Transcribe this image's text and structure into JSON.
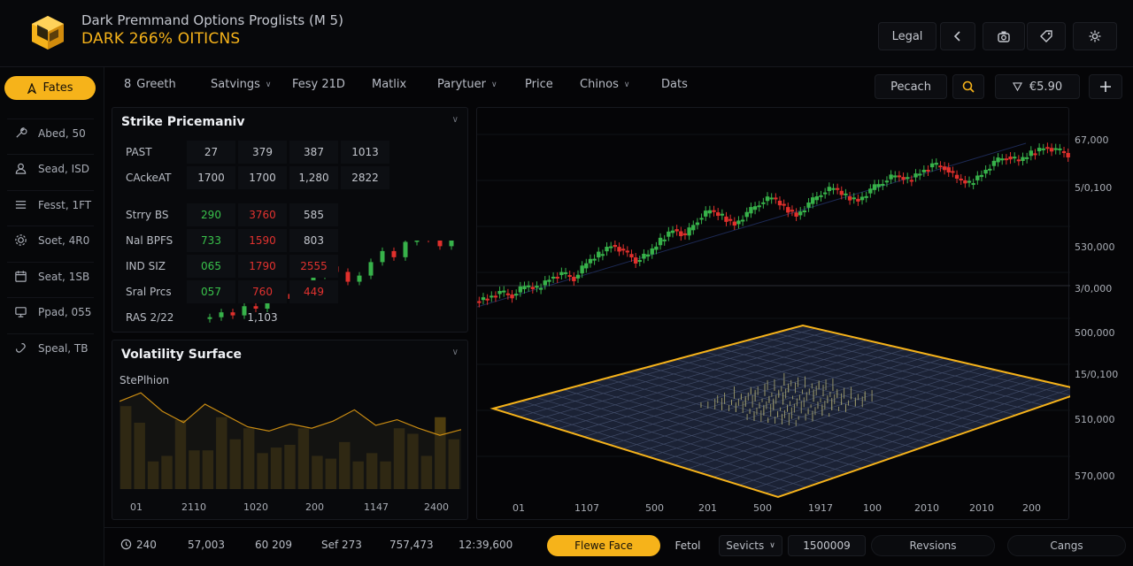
{
  "header": {
    "title": "Dark Premmand Options Proglists (M 5)",
    "subtitle": "DARK 266% OITICNS",
    "legal_label": "Legal",
    "back_icon": "chevron-left-icon",
    "icons": [
      "camera-icon",
      "tag-icon",
      "settings-icon"
    ],
    "accent": "#f5b21a"
  },
  "sidebar": {
    "primary_button": "Fates",
    "items": [
      {
        "label": "Abed, 50",
        "icon": "wrench-icon"
      },
      {
        "label": "Sead, ISD",
        "icon": "user-icon"
      },
      {
        "label": "Fesst, 1FT",
        "icon": "list-icon"
      },
      {
        "label": "Soet, 4R0",
        "icon": "gear-icon"
      },
      {
        "label": "Seat, 1SB",
        "icon": "calendar-icon"
      },
      {
        "label": "Ppad, 055",
        "icon": "monitor-icon"
      },
      {
        "label": "Speal, TB",
        "icon": "link-icon"
      }
    ]
  },
  "tabs": [
    {
      "label": "Greeth",
      "prefix": "8",
      "dropdown": false
    },
    {
      "label": "Satvings",
      "dropdown": true
    },
    {
      "label": "Fesy 21D",
      "dropdown": false
    },
    {
      "label": "Matlix",
      "dropdown": false
    },
    {
      "label": "Parytuer",
      "dropdown": true
    },
    {
      "label": "Price",
      "dropdown": false
    },
    {
      "label": "Chinos",
      "dropdown": true
    },
    {
      "label": "Dats",
      "dropdown": false
    }
  ],
  "toolbar": {
    "search_field": "Pecach",
    "price_readout": "€5.90",
    "add_icon": "plus-icon"
  },
  "strike_panel": {
    "title": "Strike Pricemaniv",
    "rows": [
      {
        "label": "PAST",
        "cells": [
          {
            "v": "27",
            "c": ""
          },
          {
            "v": "379",
            "c": ""
          },
          {
            "v": "387",
            "c": ""
          },
          {
            "v": "1013",
            "c": ""
          }
        ]
      },
      {
        "label": "CAckeAT",
        "cells": [
          {
            "v": "1700",
            "c": ""
          },
          {
            "v": "1700",
            "c": ""
          },
          {
            "v": "1,280",
            "c": ""
          },
          {
            "v": "2822",
            "c": ""
          }
        ]
      },
      {
        "label": "Strry BS",
        "cells": [
          {
            "v": "290",
            "c": "g"
          },
          {
            "v": "3760",
            "c": "r"
          },
          {
            "v": "585",
            "c": ""
          }
        ]
      },
      {
        "label": "Nal BPFS",
        "cells": [
          {
            "v": "733",
            "c": "g"
          },
          {
            "v": "1590",
            "c": "r"
          },
          {
            "v": "803",
            "c": ""
          }
        ]
      },
      {
        "label": "IND SIZ",
        "cells": [
          {
            "v": "065",
            "c": "g"
          },
          {
            "v": "1790",
            "c": "r"
          },
          {
            "v": "2555",
            "c": "r"
          }
        ]
      },
      {
        "label": "Sral Prcs",
        "cells": [
          {
            "v": "057",
            "c": "g"
          },
          {
            "v": "760",
            "c": "r"
          },
          {
            "v": "449",
            "c": "r"
          }
        ]
      },
      {
        "label": "RAS 2/22",
        "cells": [
          {
            "v": "",
            "c": ""
          },
          {
            "v": "1,103",
            "c": ""
          }
        ]
      }
    ]
  },
  "volatility_panel": {
    "title": "Volatility Surface",
    "subtitle": "StePlhion",
    "x_labels": [
      "01",
      "2110",
      "1020",
      "200",
      "1147",
      "2400"
    ]
  },
  "chart_data": [
    {
      "type": "line",
      "title": "",
      "x_labels": [
        "01",
        "2110",
        "1020",
        "200",
        "1147",
        "2400"
      ],
      "series": [
        {
          "values": [
            62,
            68,
            55,
            47,
            60,
            52,
            44,
            41,
            46,
            43,
            48,
            56,
            45,
            49,
            43,
            38,
            42
          ]
        }
      ]
    },
    {
      "type": "bar",
      "title": "",
      "values": [
        30,
        24,
        10,
        12,
        25,
        14,
        14,
        26,
        18,
        22,
        13,
        15,
        16,
        22,
        12,
        11,
        17,
        10,
        13,
        10,
        22,
        20,
        12,
        26,
        18
      ]
    },
    {
      "type": "candlestick",
      "title": "",
      "x_labels": [
        "01",
        "1107",
        "500",
        "201",
        "500",
        "1917",
        "100",
        "2010",
        "2010",
        "200"
      ],
      "y_labels": [
        "67,000",
        "5/0,100",
        "530,000",
        "3/0,000",
        "500,000",
        "15/0,100",
        "510,000",
        "570,000"
      ],
      "values": [
        282,
        290,
        285,
        300,
        296,
        312,
        320,
        312,
        336,
        350,
        365,
        356,
        340,
        350,
        372,
        390,
        380,
        405,
        420,
        410,
        398,
        415,
        432,
        440,
        425,
        412,
        430,
        448,
        455,
        442,
        436,
        452,
        466,
        475,
        468,
        480,
        492,
        488,
        470,
        462,
        478,
        496,
        505,
        498,
        510,
        520,
        516,
        508
      ]
    }
  ],
  "surface_plot": {
    "accent": "#f5b21a"
  },
  "statusbar": {
    "clock_icon": "clock-icon",
    "items": [
      "240",
      "57,003",
      "60 209",
      "Sef 273",
      "757,473",
      "12:39,600"
    ],
    "active_button": "Flewe Face",
    "feture_label": "Fetol",
    "dropdown_label": "Sevicts",
    "value_field": "1500009",
    "revisions_button": "Revsions",
    "changes_button": "Cangs"
  }
}
